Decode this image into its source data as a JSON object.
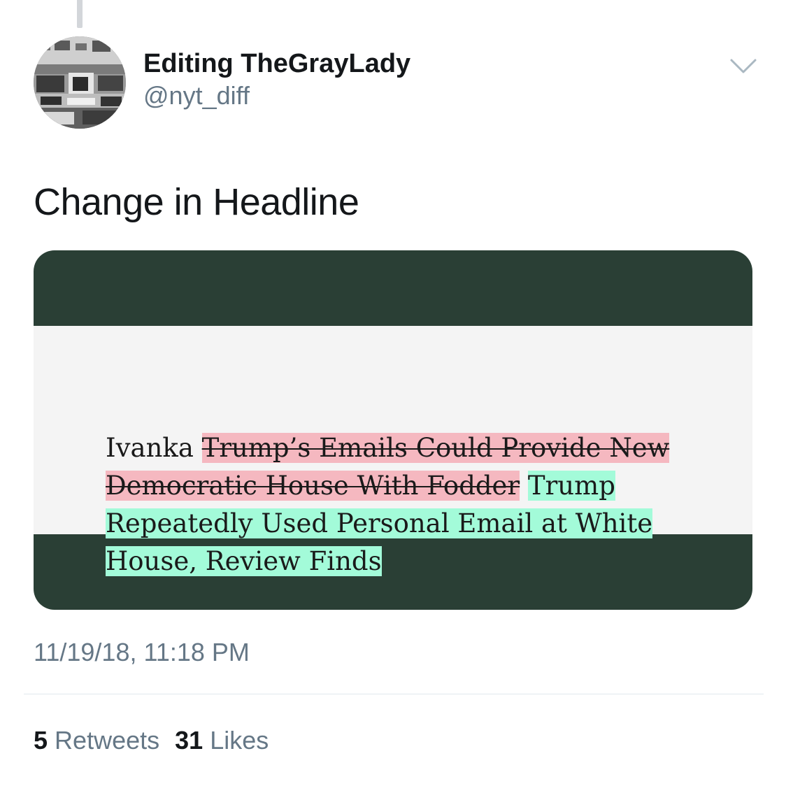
{
  "user": {
    "display_name": "Editing TheGrayLady",
    "handle": "@nyt_diff",
    "avatar": "black-and-white-newsroom-photo"
  },
  "tweet": {
    "text": "Change in Headline",
    "timestamp": "11/19/18, 11:18 PM"
  },
  "media": {
    "headline_kept": "Ivanka ",
    "headline_removed": "Trump’s Emails Could Provide New Democratic House With Fodder",
    "headline_added": "Trump Repeatedly Used Personal Email at White House, Review Finds",
    "colors": {
      "frame": "#2a3f35",
      "background": "#f4f4f4",
      "removed_highlight": "#f5b8c0",
      "added_highlight": "#a3fbd9"
    }
  },
  "stats": {
    "retweets_count": "5",
    "retweets_label": "Retweets",
    "likes_count": "31",
    "likes_label": "Likes"
  },
  "icons": {
    "menu": "chevron-down-icon"
  }
}
